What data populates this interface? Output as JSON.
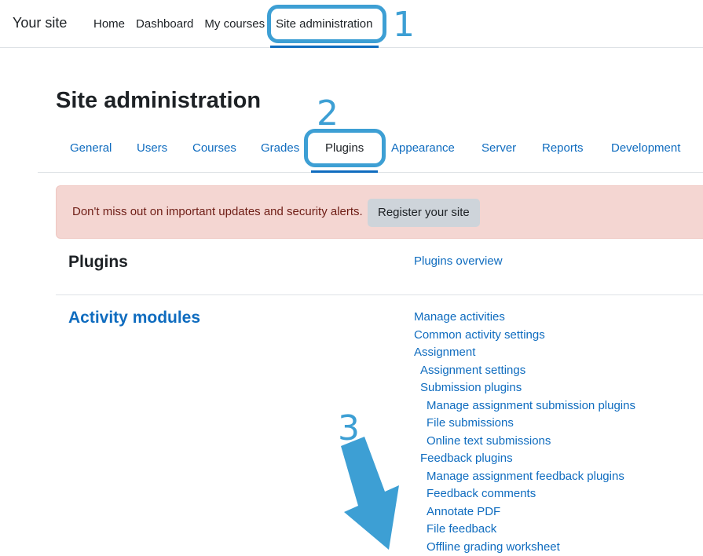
{
  "navbar": {
    "site_name": "Your site",
    "items": [
      {
        "label": "Home"
      },
      {
        "label": "Dashboard"
      },
      {
        "label": "My courses"
      },
      {
        "label": "Site administration",
        "active": true
      }
    ]
  },
  "page": {
    "title": "Site administration"
  },
  "tabs": [
    {
      "label": "General"
    },
    {
      "label": "Users"
    },
    {
      "label": "Courses"
    },
    {
      "label": "Grades"
    },
    {
      "label": "Plugins",
      "active": true
    },
    {
      "label": "Appearance"
    },
    {
      "label": "Server"
    },
    {
      "label": "Reports"
    },
    {
      "label": "Development"
    }
  ],
  "alert": {
    "message": "Don't miss out on important updates and security alerts.",
    "button_label": "Register your site"
  },
  "sections": {
    "plugins": {
      "heading": "Plugins",
      "links": [
        {
          "label": "Plugins overview"
        }
      ]
    },
    "activity_modules": {
      "heading": "Activity modules",
      "links": [
        {
          "label": "Manage activities",
          "level": 0
        },
        {
          "label": "Common activity settings",
          "level": 0
        },
        {
          "label": "Assignment",
          "level": 0
        },
        {
          "label": "Assignment settings",
          "level": 1
        },
        {
          "label": "Submission plugins",
          "level": 1
        },
        {
          "label": "Manage assignment submission plugins",
          "level": 2
        },
        {
          "label": "File submissions",
          "level": 2
        },
        {
          "label": "Online text submissions",
          "level": 2
        },
        {
          "label": "Feedback plugins",
          "level": 1
        },
        {
          "label": "Manage assignment feedback plugins",
          "level": 2
        },
        {
          "label": "Feedback comments",
          "level": 2
        },
        {
          "label": "Annotate PDF",
          "level": 2
        },
        {
          "label": "File feedback",
          "level": 2
        },
        {
          "label": "Offline grading worksheet",
          "level": 2
        }
      ]
    }
  },
  "annotations": {
    "step1": "1",
    "step2": "2",
    "step3": "3"
  },
  "colors": {
    "link": "#0f6cbf",
    "annotation": "#3d9fd4",
    "alert_bg": "#f4d6d2"
  }
}
